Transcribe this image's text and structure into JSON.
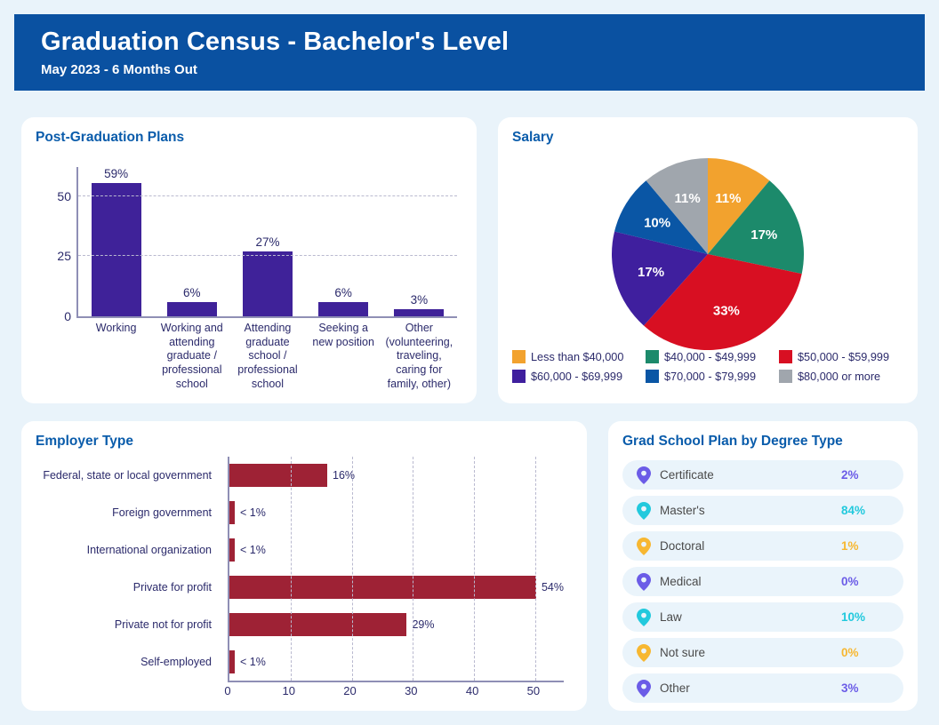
{
  "header": {
    "title": "Graduation Census -  Bachelor's Level",
    "subtitle": "May 2023 - 6 Months Out"
  },
  "plans": {
    "title": "Post-Graduation Plans"
  },
  "salary": {
    "title": "Salary"
  },
  "employer": {
    "title": "Employer Type"
  },
  "grad": {
    "title": "Grad School Plan by Degree Type",
    "rows": [
      {
        "label": "Certificate",
        "value": "2%",
        "color": "#6b5ce7",
        "icon": "map-pin-icon"
      },
      {
        "label": "Master's",
        "value": "84%",
        "color": "#22c9dd",
        "icon": "map-pin-icon"
      },
      {
        "label": "Doctoral",
        "value": "1%",
        "color": "#f7b731",
        "icon": "map-pin-icon"
      },
      {
        "label": "Medical",
        "value": "0%",
        "color": "#6b5ce7",
        "icon": "map-pin-icon"
      },
      {
        "label": "Law",
        "value": "10%",
        "color": "#22c9dd",
        "icon": "map-pin-icon"
      },
      {
        "label": "Not sure",
        "value": "0%",
        "color": "#f7b731",
        "icon": "map-pin-icon"
      },
      {
        "label": "Other",
        "value": "3%",
        "color": "#6b5ce7",
        "icon": "map-pin-icon"
      }
    ]
  },
  "chart_data": [
    {
      "type": "bar",
      "title": "Post-Graduation Plans",
      "xlabel": "",
      "ylabel": "",
      "ylim": [
        0,
        62
      ],
      "yticks": [
        0,
        25,
        50
      ],
      "grid": true,
      "bar_color": "#3f2299",
      "categories": [
        "Working",
        "Working and attending graduate / professional school",
        "Attending graduate school / professional school",
        "Seeking a new position",
        "Other (volunteering, traveling, caring for family, other)"
      ],
      "values": [
        59,
        6,
        27,
        6,
        3
      ],
      "data_labels": [
        "59%",
        "6%",
        "27%",
        "6%",
        "3%"
      ]
    },
    {
      "type": "pie",
      "title": "Salary",
      "legend_position": "bottom",
      "labels": [
        "Less than $40,000",
        "$40,000 - $49,999",
        "$50,000 - $59,999",
        "$60,000 - $69,999",
        "$70,000 - $79,999",
        "$80,000 or more"
      ],
      "values": [
        11,
        17,
        33,
        17,
        10,
        11
      ],
      "data_labels": [
        "11%",
        "17%",
        "33%",
        "17%",
        "10%",
        "11%"
      ],
      "colors": [
        "#f2a22e",
        "#1c8a6b",
        "#d80f22",
        "#3f1f9e",
        "#0a56a5",
        "#a0a6ad"
      ],
      "slice_order": "clockwise from 12 o'clock"
    },
    {
      "type": "bar",
      "orientation": "horizontal",
      "title": "Employer Type",
      "xlabel": "",
      "ylabel": "",
      "xlim": [
        0,
        57
      ],
      "xticks": [
        0,
        10,
        20,
        30,
        40,
        50
      ],
      "grid": true,
      "bar_color": "#9e2235",
      "categories": [
        "Federal, state or local government",
        "Foreign government",
        "International organization",
        "Private for profit",
        "Private not for profit",
        "Self-employed"
      ],
      "values": [
        16,
        0.5,
        0.5,
        54,
        29,
        0.5
      ],
      "data_labels": [
        "16%",
        "< 1%",
        "< 1%",
        "54%",
        "29%",
        "< 1%"
      ]
    },
    {
      "type": "table",
      "title": "Grad School Plan by Degree Type",
      "categories": [
        "Certificate",
        "Master's",
        "Doctoral",
        "Medical",
        "Law",
        "Not sure",
        "Other"
      ],
      "values": [
        2,
        84,
        1,
        0,
        10,
        0,
        3
      ],
      "data_labels": [
        "2%",
        "84%",
        "1%",
        "0%",
        "10%",
        "0%",
        "3%"
      ]
    }
  ]
}
